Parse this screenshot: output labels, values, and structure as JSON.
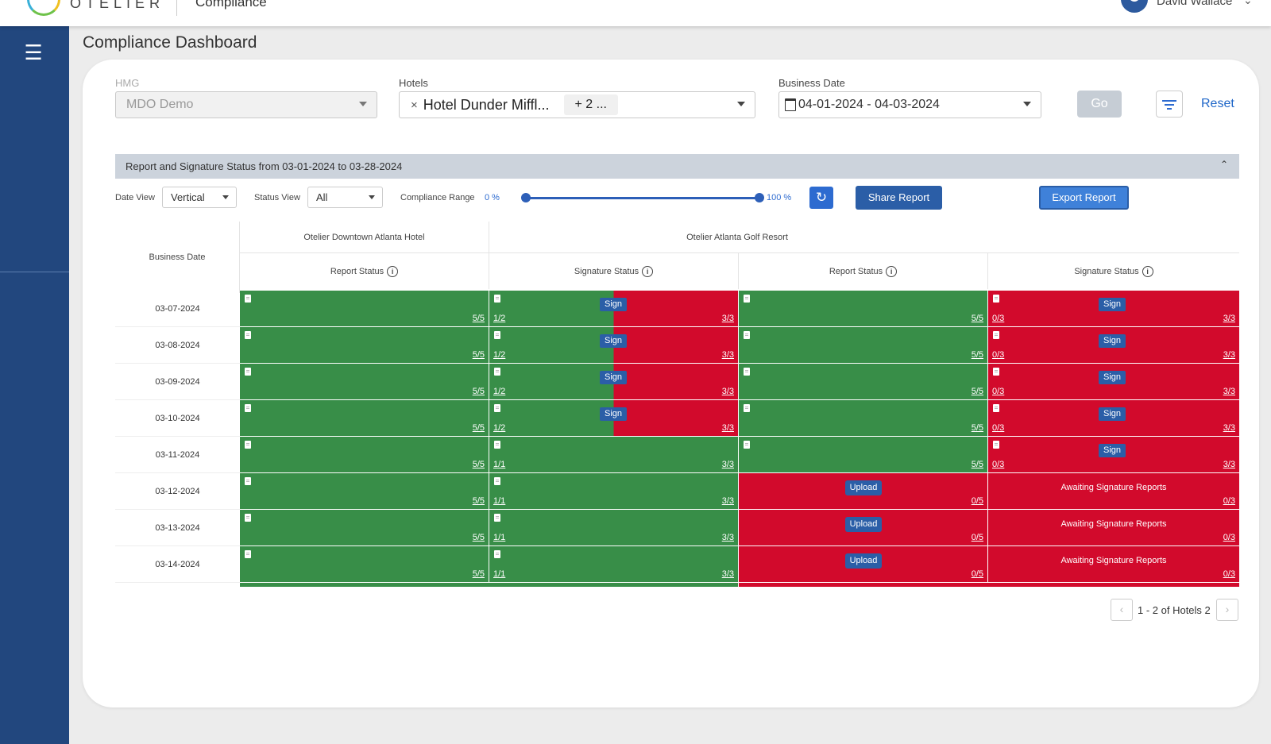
{
  "header": {
    "logo_text": "OTELIER",
    "module": "Compliance",
    "user_name": "David Wallace",
    "user_icon": "user-circle-icon",
    "menu_icon": "chevron-down-icon"
  },
  "sidebar": {
    "menu_icon": "hamburger-icon"
  },
  "page": {
    "title": "Compliance Dashboard"
  },
  "filters": {
    "hmg_label": "HMG",
    "hmg_value": "MDO Demo",
    "hotels_label": "Hotels",
    "hotel_chip": "Hotel Dunder Miffl...",
    "hotel_more": "+ 2 ...",
    "date_label": "Business Date",
    "date_value": "04-01-2024 - 04-03-2024",
    "go_label": "Go",
    "reset_label": "Reset"
  },
  "report": {
    "title": "Report and Signature Status from 03-01-2024 to 03-28-2024",
    "date_view_label": "Date View",
    "date_view_value": "Vertical",
    "status_view_label": "Status View",
    "status_view_value": "All",
    "range_label": "Compliance Range",
    "range_min": "0 %",
    "range_max": "100 %",
    "range_low_fraction": 0,
    "range_high_fraction": 1,
    "share_label": "Share Report",
    "export_label": "Export Report"
  },
  "table": {
    "date_header": "Business Date",
    "hotels": [
      "Otelier Downtown Atlanta Hotel",
      "Otelier Atlanta Golf Resort"
    ],
    "sub_headers": [
      "Report Status",
      "Signature Status",
      "Report Status",
      "Signature Status"
    ],
    "sign_label": "Sign",
    "upload_label": "Upload",
    "awaiting_label": "Awaiting Signature Reports",
    "rows": [
      {
        "date": "03-07-2024",
        "h1_report": "5/5",
        "h1_sig_signed": "1/2",
        "h1_sig_total": "3/3",
        "h1_sig_mode": "split",
        "h2_report": "5/5",
        "h2_report_mode": "green",
        "h2_sig_signed": "0/3",
        "h2_sig_total": "3/3",
        "h2_sig_mode": "sign"
      },
      {
        "date": "03-08-2024",
        "h1_report": "5/5",
        "h1_sig_signed": "1/2",
        "h1_sig_total": "3/3",
        "h1_sig_mode": "split",
        "h2_report": "5/5",
        "h2_report_mode": "green",
        "h2_sig_signed": "0/3",
        "h2_sig_total": "3/3",
        "h2_sig_mode": "sign"
      },
      {
        "date": "03-09-2024",
        "h1_report": "5/5",
        "h1_sig_signed": "1/2",
        "h1_sig_total": "3/3",
        "h1_sig_mode": "split",
        "h2_report": "5/5",
        "h2_report_mode": "green",
        "h2_sig_signed": "0/3",
        "h2_sig_total": "3/3",
        "h2_sig_mode": "sign"
      },
      {
        "date": "03-10-2024",
        "h1_report": "5/5",
        "h1_sig_signed": "1/2",
        "h1_sig_total": "3/3",
        "h1_sig_mode": "split",
        "h2_report": "5/5",
        "h2_report_mode": "green",
        "h2_sig_signed": "0/3",
        "h2_sig_total": "3/3",
        "h2_sig_mode": "sign"
      },
      {
        "date": "03-11-2024",
        "h1_report": "5/5",
        "h1_sig_signed": "1/1",
        "h1_sig_total": "3/3",
        "h1_sig_mode": "green",
        "h2_report": "5/5",
        "h2_report_mode": "green",
        "h2_sig_signed": "0/3",
        "h2_sig_total": "3/3",
        "h2_sig_mode": "sign"
      },
      {
        "date": "03-12-2024",
        "h1_report": "5/5",
        "h1_sig_signed": "1/1",
        "h1_sig_total": "3/3",
        "h1_sig_mode": "green",
        "h2_report": "0/5",
        "h2_report_mode": "upload",
        "h2_sig_signed": "",
        "h2_sig_total": "0/3",
        "h2_sig_mode": "await"
      },
      {
        "date": "03-13-2024",
        "h1_report": "5/5",
        "h1_sig_signed": "1/1",
        "h1_sig_total": "3/3",
        "h1_sig_mode": "green",
        "h2_report": "0/5",
        "h2_report_mode": "upload",
        "h2_sig_signed": "",
        "h2_sig_total": "0/3",
        "h2_sig_mode": "await"
      },
      {
        "date": "03-14-2024",
        "h1_report": "5/5",
        "h1_sig_signed": "1/1",
        "h1_sig_total": "3/3",
        "h1_sig_mode": "green",
        "h2_report": "0/5",
        "h2_report_mode": "upload",
        "h2_sig_signed": "",
        "h2_sig_total": "0/3",
        "h2_sig_mode": "await"
      }
    ]
  },
  "pager": {
    "text": "1 - 2 of Hotels 2",
    "prev_icon": "chevron-left-icon",
    "next_icon": "chevron-right-icon"
  },
  "colors": {
    "green": "#388e48",
    "red": "#d20a2c",
    "primary": "#2b5ea7",
    "sidebar": "#22477e"
  }
}
